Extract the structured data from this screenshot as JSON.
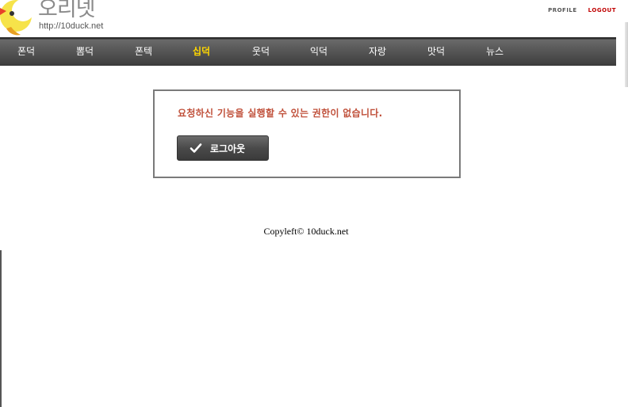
{
  "logo": {
    "title": "오리넷",
    "url": "http://10duck.net"
  },
  "top_links": {
    "profile": "PROFILE",
    "logout": "LOGOUT"
  },
  "nav": {
    "items": [
      {
        "label": "폰덕",
        "active": false
      },
      {
        "label": "뽐덕",
        "active": false
      },
      {
        "label": "폰텍",
        "active": false
      },
      {
        "label": "십덕",
        "active": true
      },
      {
        "label": "웃덕",
        "active": false
      },
      {
        "label": "익덕",
        "active": false
      },
      {
        "label": "자랑",
        "active": false
      },
      {
        "label": "맛덕",
        "active": false
      },
      {
        "label": "뉴스",
        "active": false
      }
    ]
  },
  "message": {
    "text": "요청하신 기능을 실행할 수 있는 권한이 없습니다.",
    "button_label": "로그아웃",
    "button_icon": "check-icon"
  },
  "footer": {
    "copyright": "Copyleft© 10duck.net"
  },
  "colors": {
    "nav_active": "#ffd700",
    "message_text": "#c0503a",
    "logout_link": "#c00000"
  }
}
